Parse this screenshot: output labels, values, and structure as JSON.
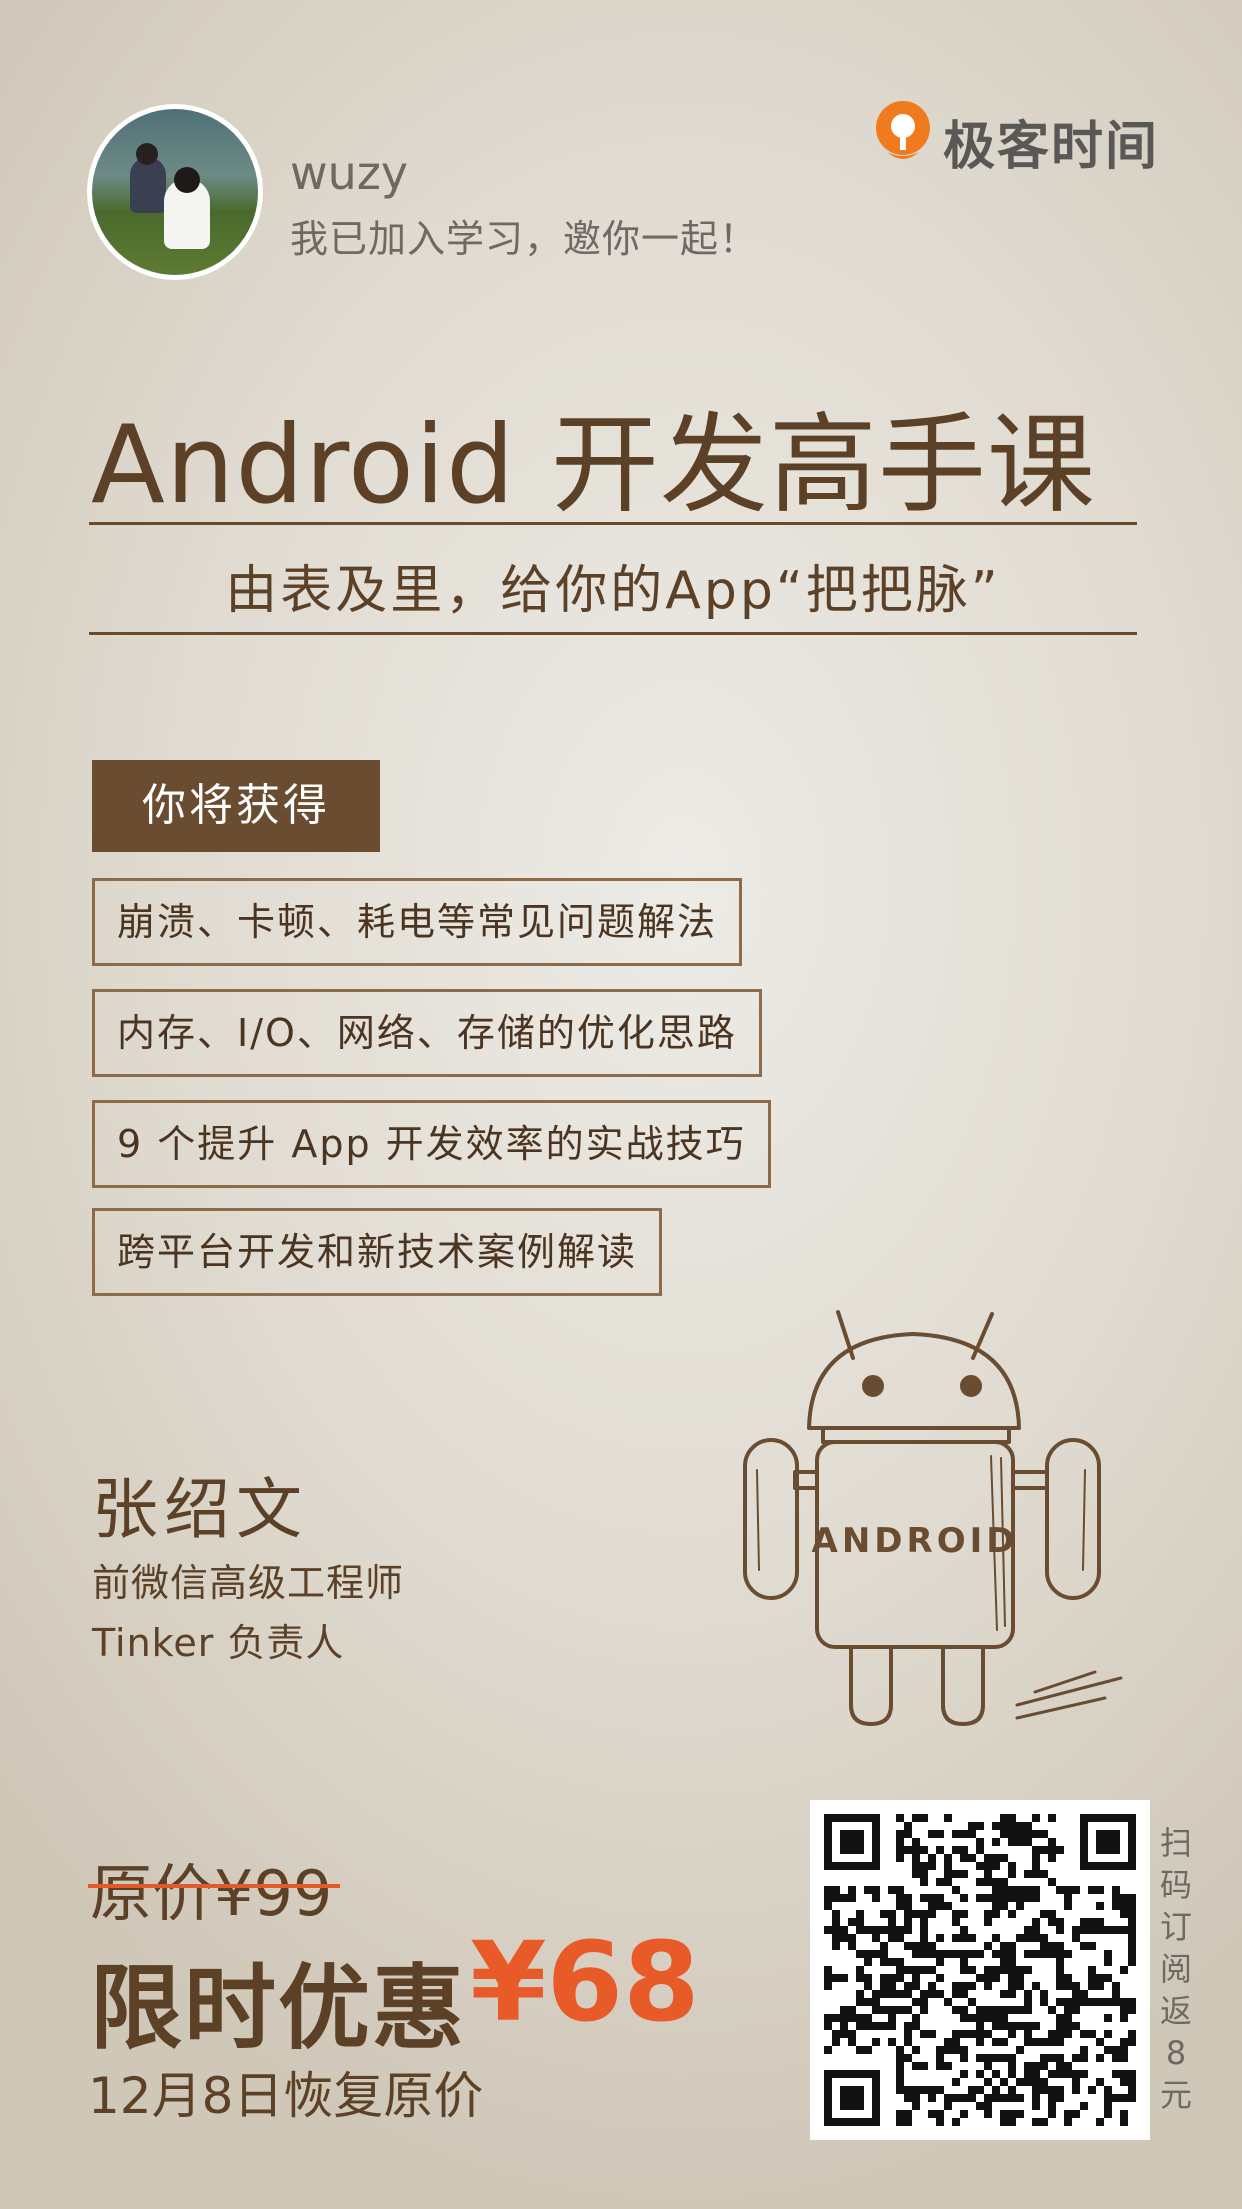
{
  "header": {
    "username": "wuzy",
    "invite_text": "我已加入学习，邀你一起！",
    "brand_name": "极客时间"
  },
  "course": {
    "title": "Android 开发高手课",
    "subtitle": "由表及里，给你的App“把把脉”"
  },
  "gains": {
    "label": "你将获得",
    "items": [
      "崩溃、卡顿、耗电等常见问题解法",
      "内存、I/O、网络、存储的优化思路",
      "9 个提升 App 开发效率的实战技巧",
      "跨平台开发和新技术案例解读"
    ]
  },
  "teacher": {
    "name": "张绍文",
    "title1": "前微信高级工程师",
    "title2": "Tinker 负责人"
  },
  "illustration": {
    "robot_text": "ANDROID"
  },
  "pricing": {
    "original": "原价¥99",
    "promo_label": "限时优惠",
    "promo_price": "¥68",
    "restore_note": "12月8日恢复原价"
  },
  "qr": {
    "caption": [
      "扫",
      "码",
      "订",
      "阅",
      "返",
      "8",
      "元"
    ]
  },
  "colors": {
    "brown": "#5c4126",
    "tag_bg": "#6a4c31",
    "accent_orange": "#e85a28",
    "logo_orange": "#f07a1e"
  }
}
